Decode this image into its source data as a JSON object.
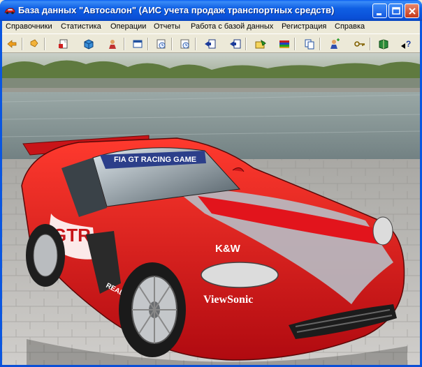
{
  "window": {
    "title": "База данных \"Автосалон\" (АИС учета продаж транспортных средств)",
    "controls": [
      "minimize-icon",
      "maximize-icon",
      "close-icon"
    ]
  },
  "menu": {
    "items": [
      "Справочники",
      "Статистика",
      "Операции",
      "Отчеты",
      "Работа с базой данных",
      "Регистрация",
      "Справка"
    ]
  },
  "toolbar": {
    "buttons": [
      "arrow-back-icon",
      "arrow-forward-icon",
      "document-icon",
      "box-icon",
      "person-icon",
      "window-icon",
      "clock-icon",
      "clock-icon",
      "import-icon",
      "export-icon",
      "folder-icon",
      "books-icon",
      "copy-icon",
      "user-add-icon",
      "key-icon",
      "book-icon",
      "help-icon"
    ]
  },
  "photo": {
    "decals": {
      "banner": "FIA GT RACING GAME",
      "logo_gtr": "GTR",
      "sponsor_kw": "K&W",
      "sponsor_viewsonic": "ViewSonic",
      "sponsor_real": "REAL"
    }
  },
  "colors": {
    "titlebar": "#0a55e3",
    "car_red": "#e2141c",
    "stripe_silver": "#b7bcc4",
    "water": "#8e9ea2",
    "pavement": "#b9b7b3"
  }
}
